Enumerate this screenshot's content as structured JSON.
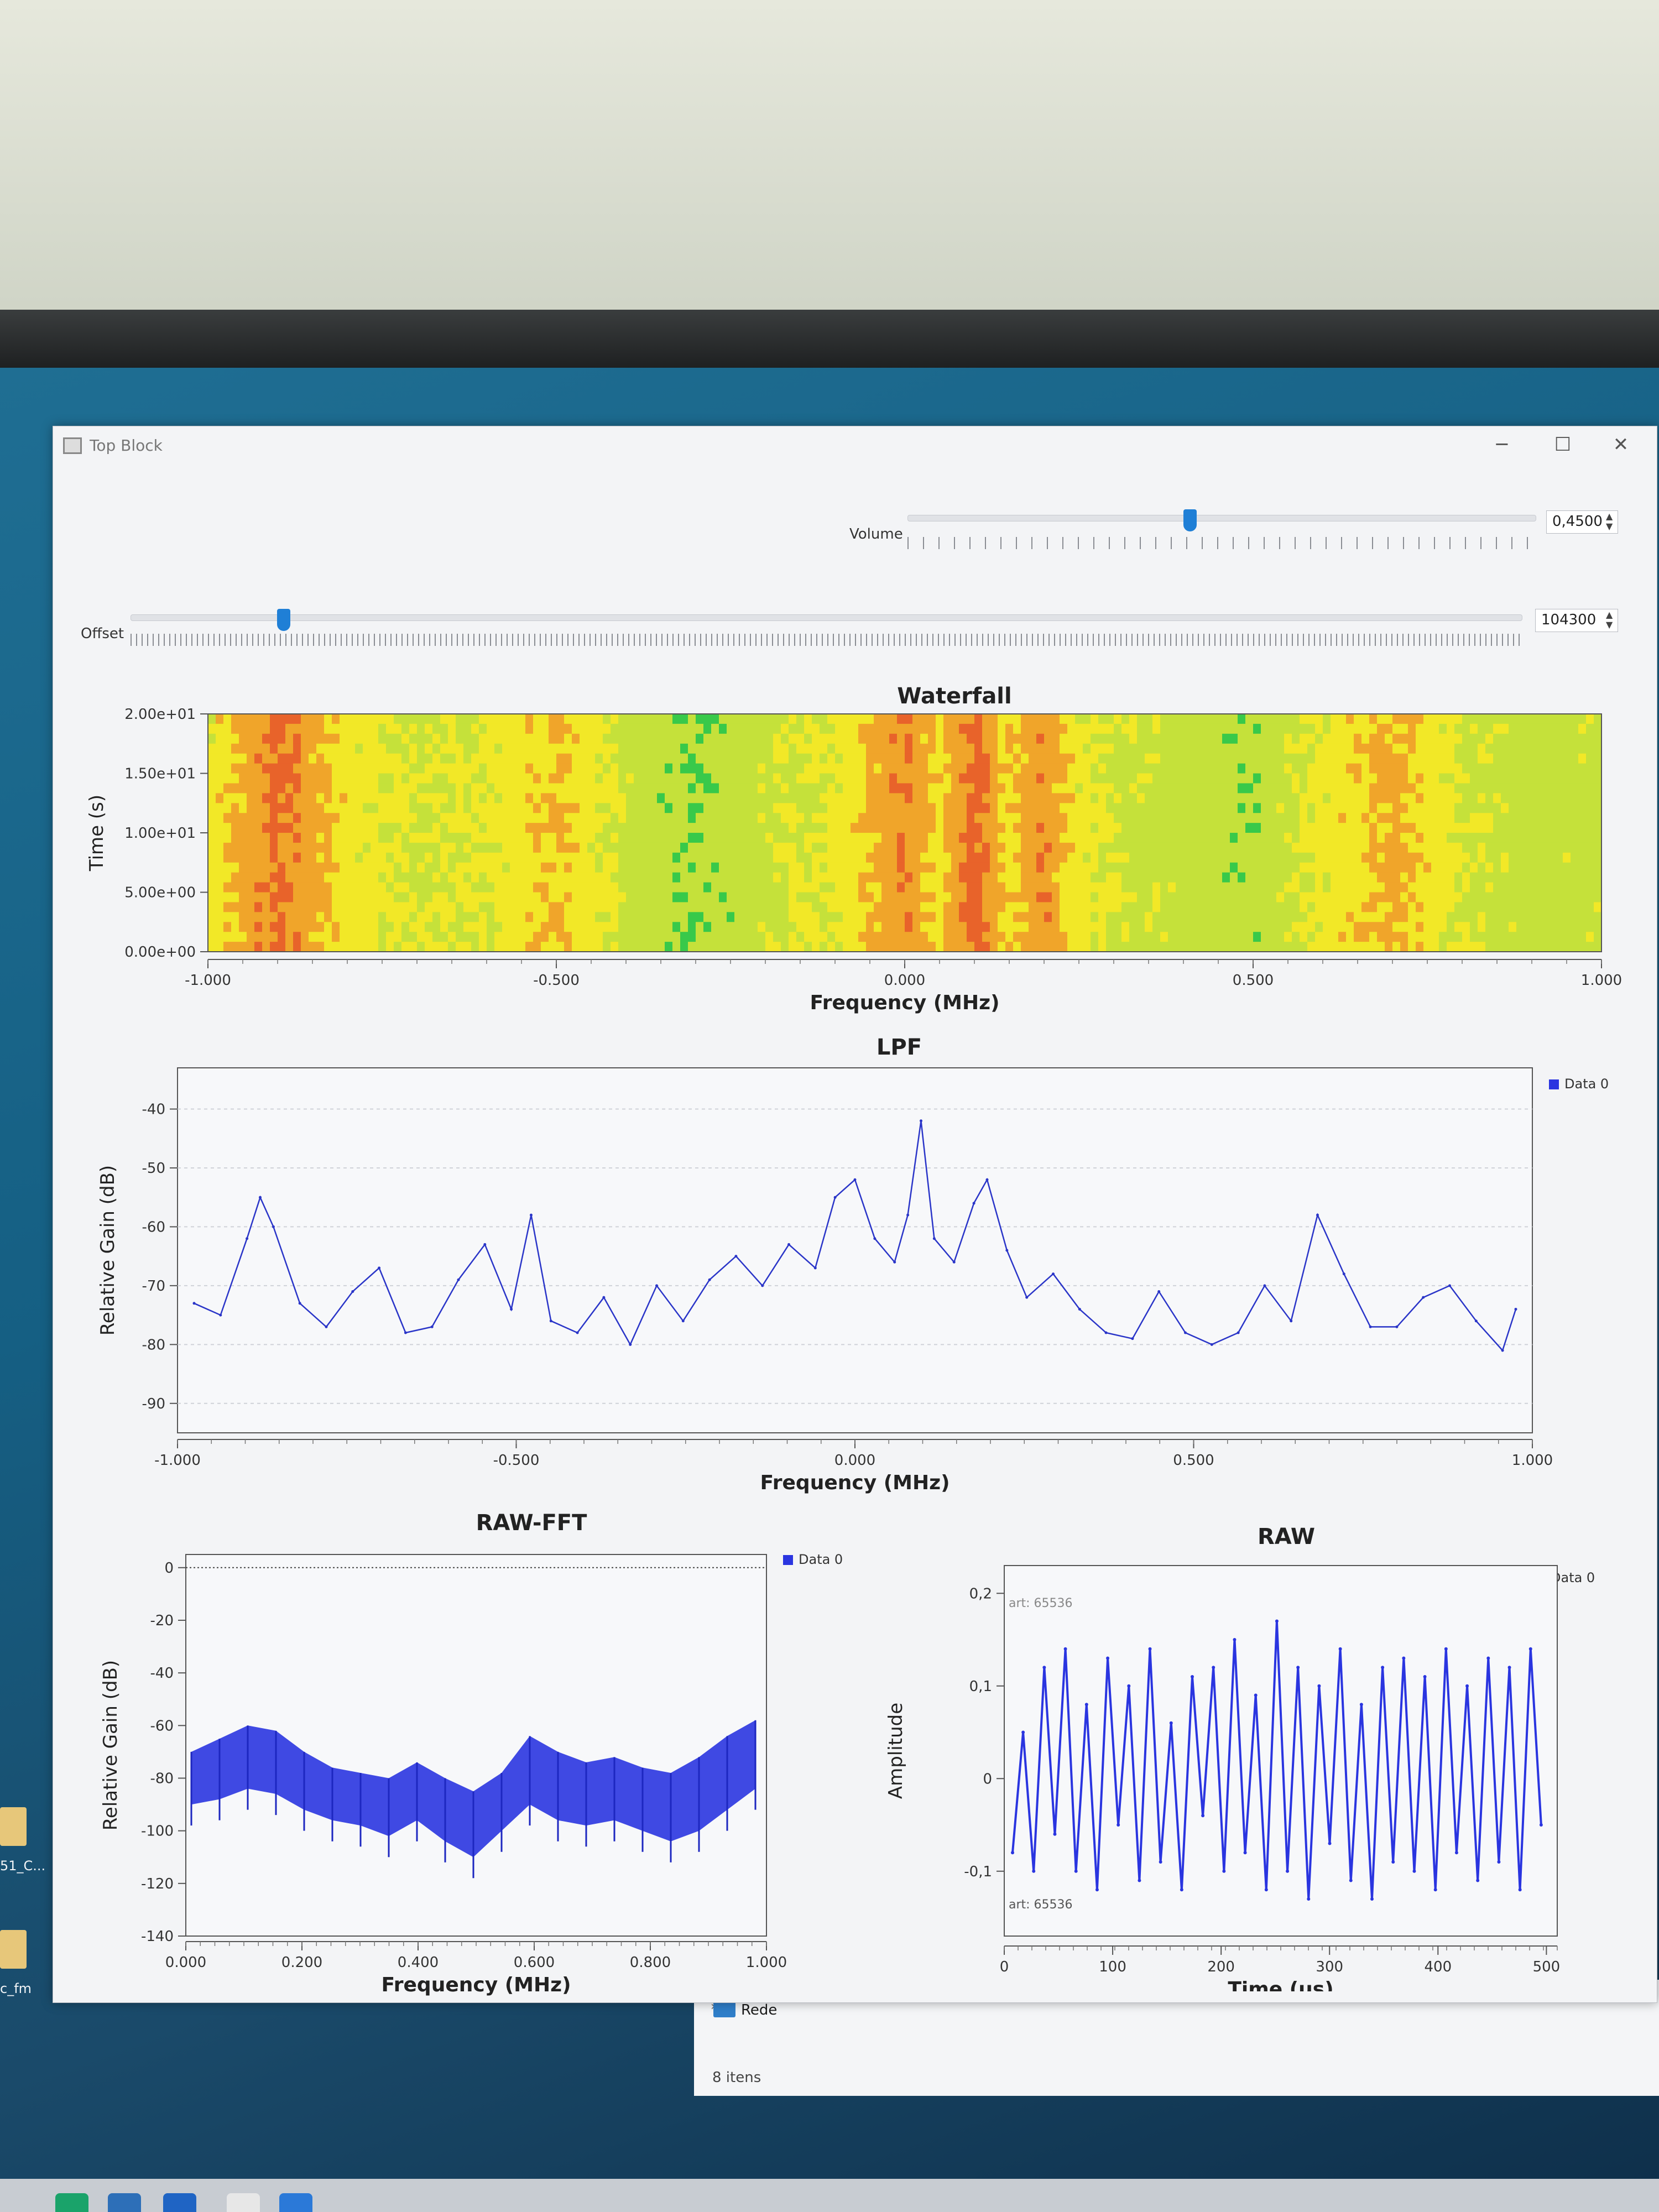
{
  "window": {
    "title": "Top Block",
    "controls": [
      "─",
      "☐",
      "✕"
    ]
  },
  "volume": {
    "label": "Volume",
    "value": "0,4500",
    "fraction": 0.45
  },
  "offset": {
    "label": "Offset",
    "value": "104300",
    "fraction": 0.11
  },
  "explorer": {
    "item": "Rede",
    "count": "8 itens"
  },
  "desktop": {
    "files": [
      "51_C...",
      "c_fm"
    ]
  },
  "charts": {
    "waterfall": {
      "title": "Waterfall"
    },
    "lpf": {
      "title": "LPF"
    },
    "rawfft": {
      "title": "RAW-FFT"
    },
    "raw": {
      "title": "RAW"
    }
  },
  "chart_data": [
    {
      "type": "heatmap",
      "title": "Waterfall",
      "xlabel": "Frequency (MHz)",
      "ylabel": "Time (s)",
      "xlim": [
        -1.0,
        1.0
      ],
      "ylim": [
        0,
        20
      ],
      "xticks": [
        "-1.000",
        "-0.500",
        "0.000",
        "0.500",
        "1.000"
      ],
      "yticks": [
        "0.00e+00",
        "5.00e+00",
        "1.00e+01",
        "1.50e+01",
        "2.00e+01"
      ],
      "colormap": [
        "#38c94a",
        "#c5e13a",
        "#f2e827",
        "#f0a52a",
        "#e8632a"
      ],
      "band_frequencies": [
        -1.0,
        -0.9,
        -0.8,
        -0.7,
        -0.6,
        -0.5,
        -0.4,
        -0.3,
        -0.2,
        -0.1,
        0.0,
        0.05,
        0.1,
        0.15,
        0.2,
        0.25,
        0.3,
        0.4,
        0.5,
        0.6,
        0.7,
        0.8,
        0.9,
        1.0
      ],
      "band_intensity": [
        0.45,
        0.95,
        0.5,
        0.35,
        0.4,
        0.65,
        0.3,
        0.15,
        0.3,
        0.45,
        0.85,
        0.55,
        1.0,
        0.55,
        0.85,
        0.45,
        0.35,
        0.25,
        0.2,
        0.45,
        0.7,
        0.35,
        0.25,
        0.3
      ]
    },
    {
      "type": "line",
      "title": "LPF",
      "xlabel": "Frequency (MHz)",
      "ylabel": "Relative Gain (dB)",
      "xlim": [
        -1.0,
        1.0
      ],
      "ylim": [
        -95,
        -33
      ],
      "xticks": [
        "-1.000",
        "-0.500",
        "0.000",
        "0.500",
        "1.000"
      ],
      "yticks": [
        "-40",
        "-50",
        "-60",
        "-70",
        "-80",
        "-90"
      ],
      "legend": [
        "Data 0"
      ],
      "series": [
        {
          "name": "Data 0",
          "x": [
            -1.0,
            -0.96,
            -0.92,
            -0.9,
            -0.88,
            -0.84,
            -0.8,
            -0.76,
            -0.72,
            -0.68,
            -0.64,
            -0.6,
            -0.56,
            -0.52,
            -0.49,
            -0.46,
            -0.42,
            -0.38,
            -0.34,
            -0.3,
            -0.26,
            -0.22,
            -0.18,
            -0.14,
            -0.1,
            -0.06,
            -0.03,
            0.0,
            0.03,
            0.06,
            0.08,
            0.1,
            0.12,
            0.15,
            0.18,
            0.2,
            0.23,
            0.26,
            0.3,
            0.34,
            0.38,
            0.42,
            0.46,
            0.5,
            0.54,
            0.58,
            0.62,
            0.66,
            0.7,
            0.74,
            0.78,
            0.82,
            0.86,
            0.9,
            0.94,
            0.98,
            1.0
          ],
          "y": [
            -73,
            -75,
            -62,
            -55,
            -60,
            -73,
            -77,
            -71,
            -67,
            -78,
            -77,
            -69,
            -63,
            -74,
            -58,
            -76,
            -78,
            -72,
            -80,
            -70,
            -76,
            -69,
            -65,
            -70,
            -63,
            -67,
            -55,
            -52,
            -62,
            -66,
            -58,
            -42,
            -62,
            -66,
            -56,
            -52,
            -64,
            -72,
            -68,
            -74,
            -78,
            -79,
            -71,
            -78,
            -80,
            -78,
            -70,
            -76,
            -58,
            -68,
            -77,
            -77,
            -72,
            -70,
            -76,
            -81,
            -74
          ]
        }
      ]
    },
    {
      "type": "area",
      "title": "RAW-FFT",
      "xlabel": "Frequency (MHz)",
      "ylabel": "Relative Gain (dB)",
      "xlim": [
        0.0,
        1.0
      ],
      "ylim": [
        -140,
        5
      ],
      "xticks": [
        "0.000",
        "0.200",
        "0.400",
        "0.600",
        "0.800",
        "1.000"
      ],
      "yticks": [
        "0",
        "-20",
        "-40",
        "-60",
        "-80",
        "-100",
        "-120",
        "-140"
      ],
      "legend": [
        "Data 0"
      ],
      "series": [
        {
          "name": "Data 0",
          "x": [
            0.0,
            0.05,
            0.1,
            0.15,
            0.2,
            0.25,
            0.3,
            0.35,
            0.4,
            0.45,
            0.5,
            0.55,
            0.6,
            0.65,
            0.7,
            0.75,
            0.8,
            0.85,
            0.9,
            0.95,
            1.0
          ],
          "upper": [
            -70,
            -65,
            -60,
            -62,
            -70,
            -76,
            -78,
            -80,
            -74,
            -80,
            -85,
            -78,
            -64,
            -70,
            -74,
            -72,
            -76,
            -78,
            -72,
            -64,
            -58
          ],
          "lower": [
            -90,
            -88,
            -84,
            -86,
            -92,
            -96,
            -98,
            -102,
            -96,
            -104,
            -110,
            -100,
            -90,
            -96,
            -98,
            -96,
            -100,
            -104,
            -100,
            -92,
            -84
          ]
        }
      ]
    },
    {
      "type": "line",
      "title": "RAW",
      "xlabel": "Time (us)",
      "ylabel": "Amplitude",
      "xlim": [
        0,
        510
      ],
      "ylim": [
        -0.17,
        0.23
      ],
      "xticks": [
        "0",
        "100",
        "200",
        "300",
        "400",
        "500"
      ],
      "yticks": [
        "0,2",
        "0,1",
        "0",
        "-0,1"
      ],
      "legend": [
        "Data 0"
      ],
      "annotations": [
        "art: 65536",
        "art: 65536"
      ],
      "series": [
        {
          "name": "Data 0",
          "x": [
            0,
            10,
            20,
            30,
            40,
            50,
            60,
            70,
            80,
            90,
            100,
            110,
            120,
            130,
            140,
            150,
            160,
            170,
            180,
            190,
            200,
            210,
            220,
            230,
            240,
            250,
            260,
            270,
            280,
            290,
            300,
            310,
            320,
            330,
            340,
            350,
            360,
            370,
            380,
            390,
            400,
            410,
            420,
            430,
            440,
            450,
            460,
            470,
            480,
            490,
            500
          ],
          "y": [
            -0.08,
            0.05,
            -0.1,
            0.12,
            -0.06,
            0.14,
            -0.1,
            0.08,
            -0.12,
            0.13,
            -0.05,
            0.1,
            -0.11,
            0.14,
            -0.09,
            0.06,
            -0.12,
            0.11,
            -0.04,
            0.12,
            -0.1,
            0.15,
            -0.08,
            0.09,
            -0.12,
            0.17,
            -0.1,
            0.12,
            -0.13,
            0.1,
            -0.07,
            0.14,
            -0.11,
            0.08,
            -0.13,
            0.12,
            -0.09,
            0.13,
            -0.1,
            0.11,
            -0.12,
            0.14,
            -0.08,
            0.1,
            -0.11,
            0.13,
            -0.09,
            0.12,
            -0.12,
            0.14,
            -0.05
          ]
        }
      ]
    }
  ]
}
